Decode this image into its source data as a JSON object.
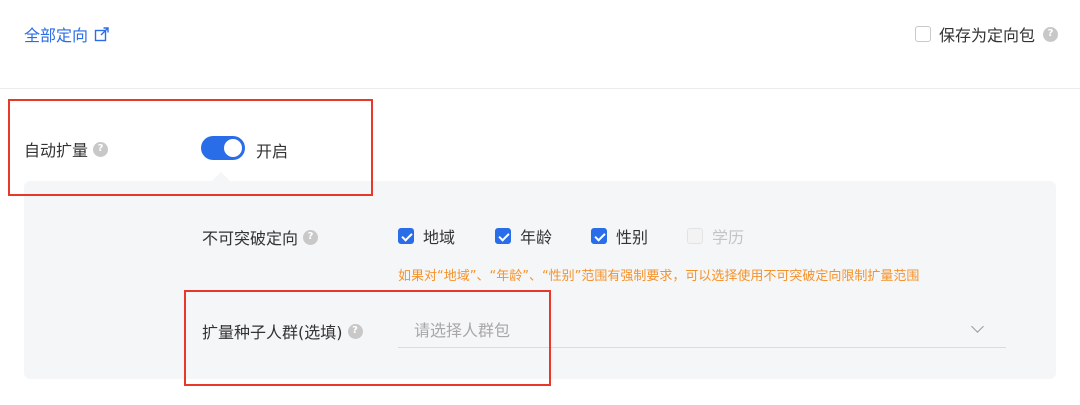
{
  "top": {
    "all_targeting_link": "全部定向",
    "save_as_package_label": "保存为定向包"
  },
  "auto_expand": {
    "label": "自动扩量",
    "toggle_state_text": "开启",
    "toggle_on": true
  },
  "unbreakable_targeting": {
    "label": "不可突破定向",
    "options": [
      {
        "label": "地域",
        "checked": true,
        "disabled": false
      },
      {
        "label": "年龄",
        "checked": true,
        "disabled": false
      },
      {
        "label": "性别",
        "checked": true,
        "disabled": false
      },
      {
        "label": "学历",
        "checked": false,
        "disabled": true
      }
    ],
    "hint": "如果对“地域”、“年龄”、“性别”范围有强制要求，可以选择使用不可突破定向限制扩量范围"
  },
  "seed_audience": {
    "label": "扩量种子人群(选填)",
    "placeholder": "请选择人群包"
  },
  "colors": {
    "accent": "#2a6de8",
    "hint": "#f5922a",
    "annotation_box": "#e8382c",
    "panel_bg": "#f5f6f8"
  },
  "icons": {
    "external_link": "external-link-icon",
    "help": "question-circle-icon",
    "dropdown": "chevron-down-icon"
  }
}
